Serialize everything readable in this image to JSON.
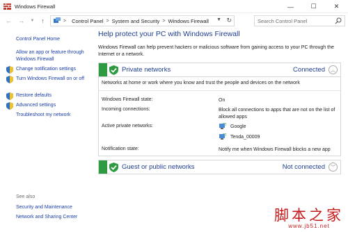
{
  "window": {
    "title": "Windows Firewall",
    "minimize": "—",
    "maximize": "☐",
    "close": "✕"
  },
  "address": {
    "back": "←",
    "forward": "→",
    "up": "↑",
    "crumbs": [
      "Control Panel",
      "System and Security",
      "Windows Firewall"
    ],
    "separator": ">",
    "search_placeholder": "Search Control Panel"
  },
  "sidebar": {
    "home": "Control Panel Home",
    "links": [
      {
        "label": "Allow an app or feature through Windows Firewall",
        "shield": false
      },
      {
        "label": "Change notification settings",
        "shield": true
      },
      {
        "label": "Turn Windows Firewall on or off",
        "shield": true
      },
      {
        "label": "Restore defaults",
        "shield": true
      },
      {
        "label": "Advanced settings",
        "shield": true
      },
      {
        "label": "Troubleshoot my network",
        "shield": false
      }
    ],
    "see_also": "See also",
    "see_also_links": [
      "Security and Maintenance",
      "Network and Sharing Center"
    ]
  },
  "main": {
    "heading": "Help protect your PC with Windows Firewall",
    "description": "Windows Firewall can help prevent hackers or malicious software from gaining access to your PC through the Internet or a network.",
    "private": {
      "title": "Private networks",
      "status": "Connected",
      "note": "Networks at home or work where you know and trust the people and devices on the network",
      "rows": {
        "state_label": "Windows Firewall state:",
        "state_value": "On",
        "incoming_label": "Incoming connections:",
        "incoming_value": "Block all connections to apps that are not on the list of allowed apps",
        "active_label": "Active private networks:",
        "networks": [
          "Google",
          "Tenda_00009"
        ],
        "notify_label": "Notification state:",
        "notify_value": "Notify me when Windows Firewall blocks a new app"
      }
    },
    "public": {
      "title": "Guest or public networks",
      "status": "Not connected"
    }
  },
  "watermark": {
    "cn": "脚本之家",
    "url": "www.jb51.net"
  },
  "colors": {
    "link": "#1a3ea8",
    "heading": "#1e3d8f",
    "green": "#2e9b43",
    "watermark": "#c51818"
  }
}
